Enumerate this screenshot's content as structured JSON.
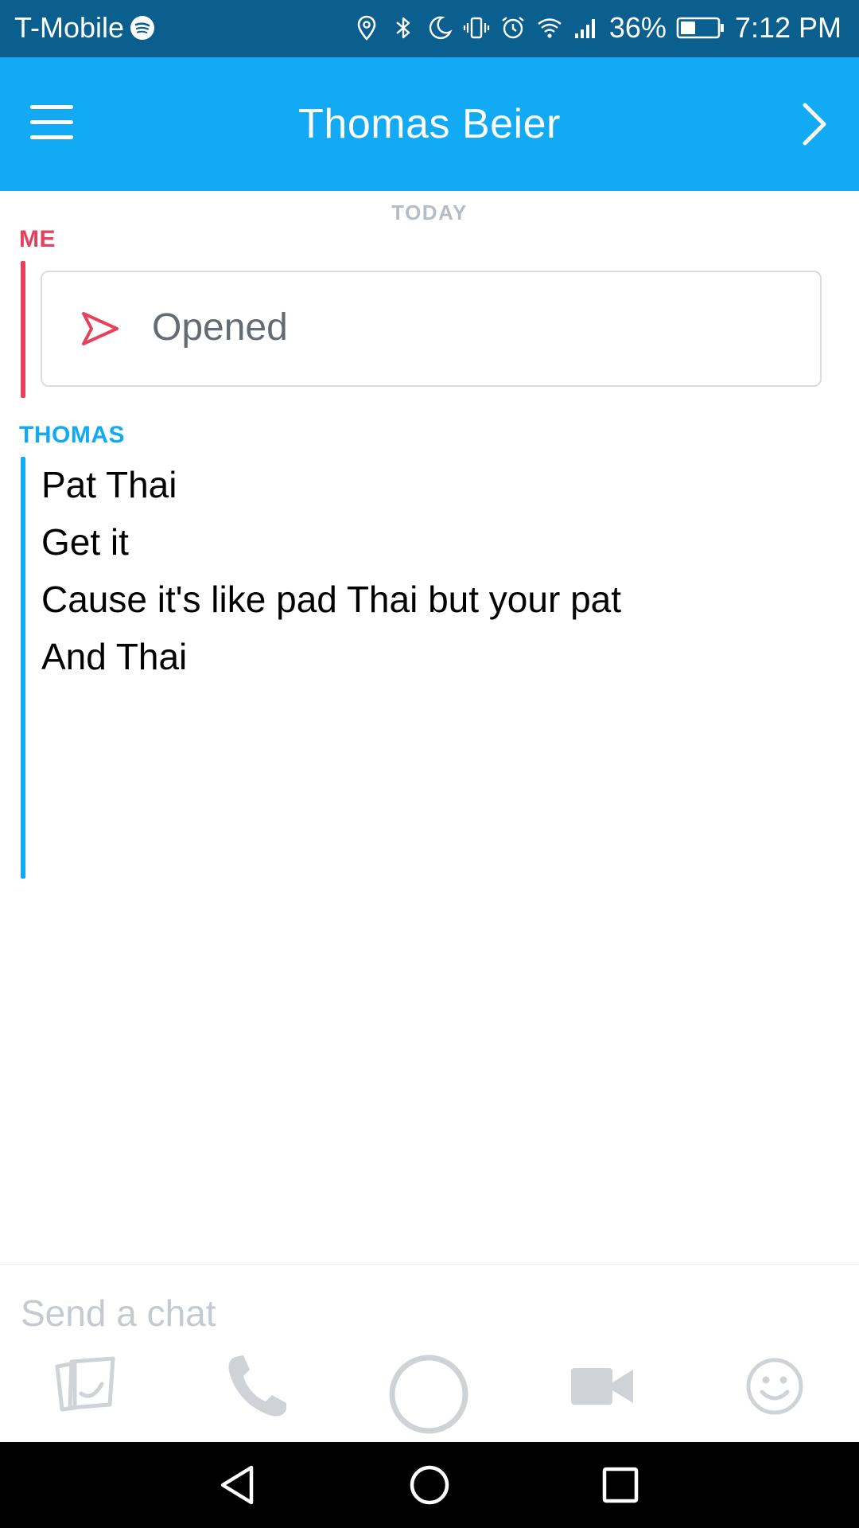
{
  "status_bar": {
    "carrier": "T-Mobile",
    "battery": "36%",
    "time": "7:12 PM",
    "icons": [
      "spotify-icon",
      "location-icon",
      "bluetooth-icon",
      "moon-icon",
      "vibrate-icon",
      "alarm-icon",
      "wifi-icon",
      "signal-icon",
      "battery-icon"
    ]
  },
  "header": {
    "title": "Thomas Beier",
    "menu_icon": "hamburger-menu-icon",
    "next_icon": "chevron-right-icon"
  },
  "chat": {
    "date_separator": "TODAY",
    "me": {
      "label": "ME",
      "snap_status": "Opened",
      "snap_icon": "send-arrow-icon"
    },
    "thomas": {
      "label": "THOMAS",
      "messages": [
        "Pat Thai",
        "Get it",
        "Cause it's like pad Thai but your pat",
        "And Thai"
      ]
    }
  },
  "composer": {
    "placeholder": "Send a chat",
    "tools": [
      "stickers-icon",
      "phone-icon",
      "capture-button",
      "video-camera-icon",
      "emoji-icon"
    ]
  },
  "navbar": {
    "buttons": [
      "back-icon",
      "home-icon",
      "recents-icon"
    ]
  },
  "colors": {
    "header": "#12aaf5",
    "status_bar": "#0b5f8e",
    "me_accent": "#e5415c",
    "friend_accent": "#12aaf5",
    "tool_gray": "#cfd3d8"
  }
}
